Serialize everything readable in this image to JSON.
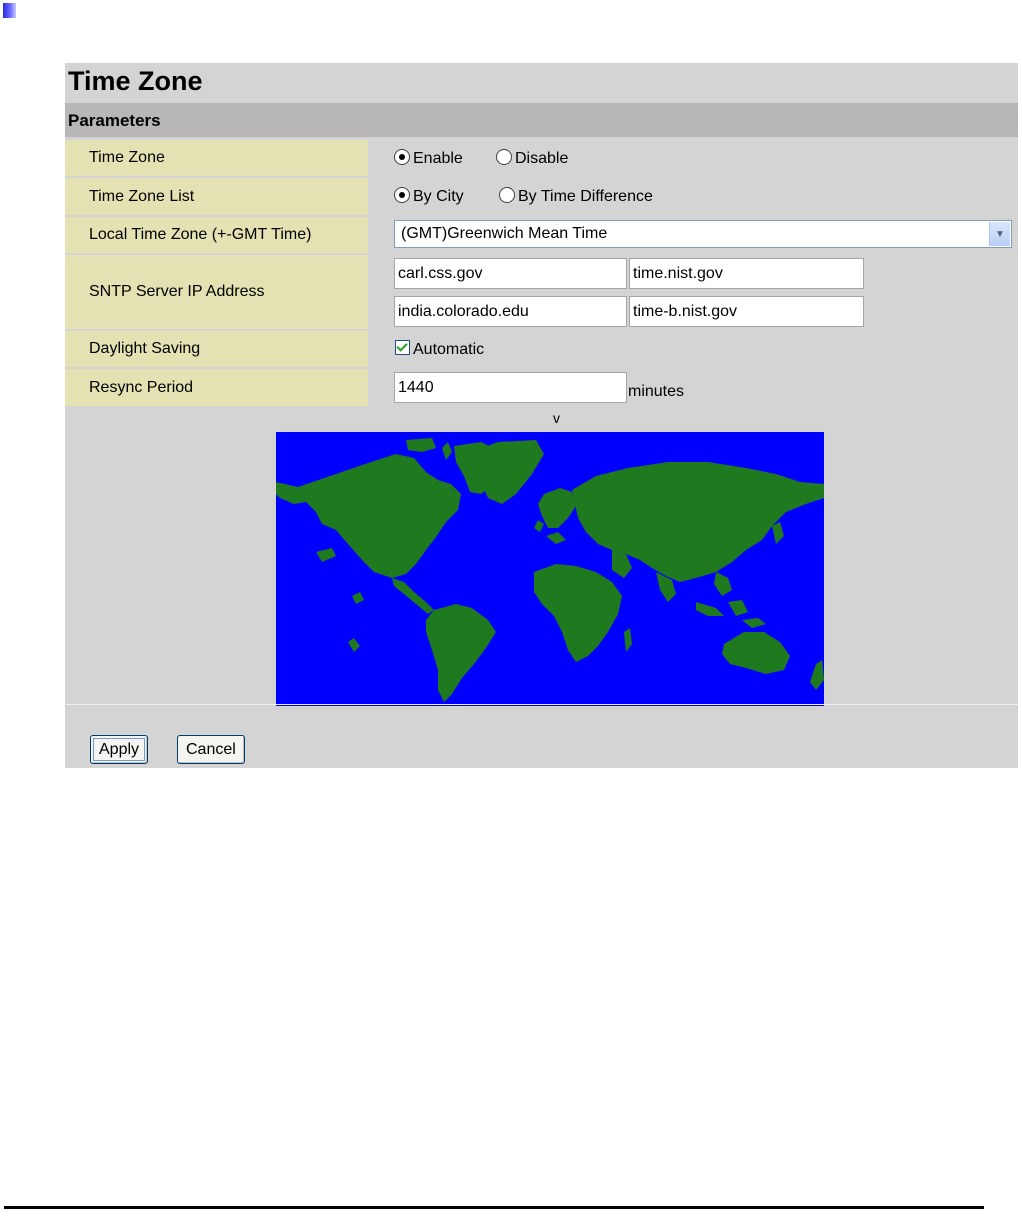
{
  "title": "Time Zone",
  "section": "Parameters",
  "time_zone": {
    "label": "Time Zone",
    "options": [
      {
        "label": "Enable",
        "selected": true
      },
      {
        "label": "Disable",
        "selected": false
      }
    ]
  },
  "time_zone_list": {
    "label": "Time Zone List",
    "options": [
      {
        "label": "By City",
        "selected": true
      },
      {
        "label": "By Time Difference",
        "selected": false
      }
    ]
  },
  "local_time_zone": {
    "label": "Local Time Zone (+-GMT Time)",
    "value": "(GMT)Greenwich Mean Time"
  },
  "sntp": {
    "label": "SNTP Server IP Address",
    "servers": [
      "carl.css.gov",
      "time.nist.gov",
      "india.colorado.edu",
      "time-b.nist.gov"
    ]
  },
  "daylight_saving": {
    "label": "Daylight Saving",
    "checkbox_label": "Automatic",
    "checked": true
  },
  "resync": {
    "label": "Resync Period",
    "value": "1440",
    "unit": "minutes"
  },
  "map": {
    "marker": "v",
    "ocean_color": "#0000ff",
    "land_color": "#1f7a1f"
  },
  "buttons": {
    "apply": "Apply",
    "cancel": "Cancel"
  }
}
